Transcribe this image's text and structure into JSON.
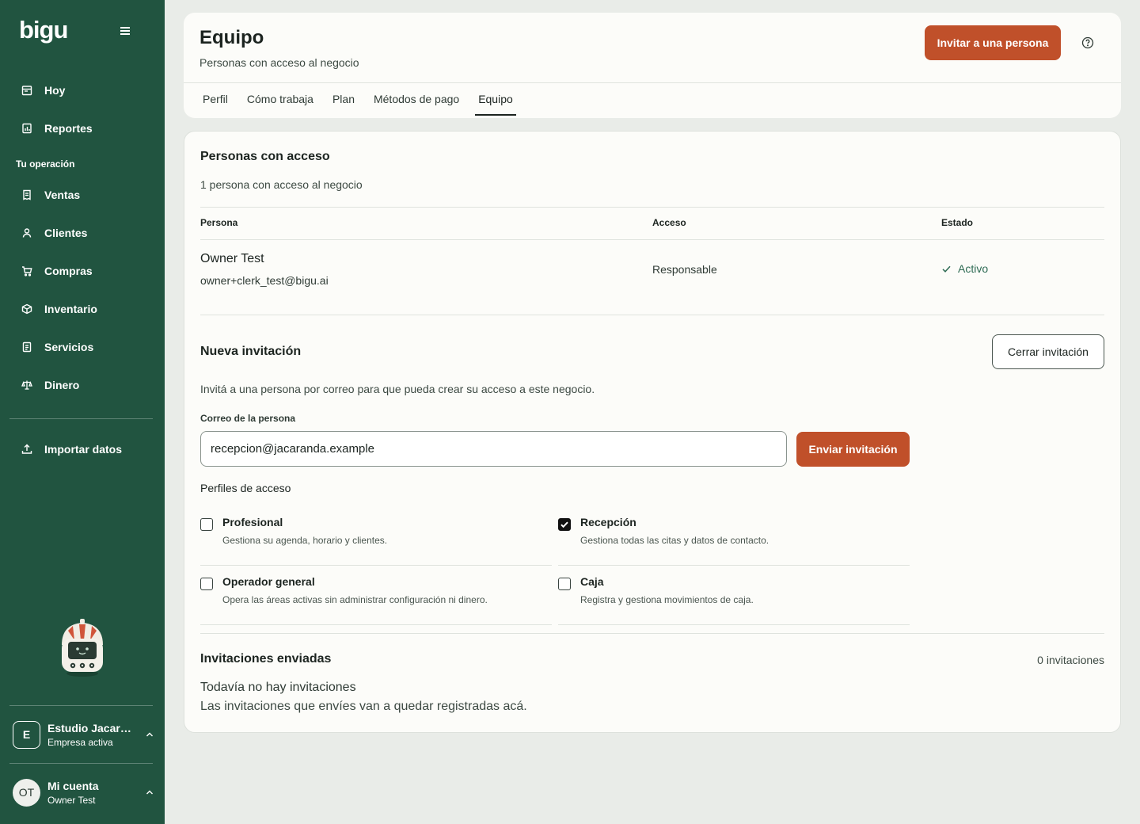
{
  "app": {
    "logo": "bigu"
  },
  "sidebar": {
    "items": [
      {
        "label": "Hoy",
        "icon": "calendar-icon"
      },
      {
        "label": "Reportes",
        "icon": "report-icon"
      }
    ],
    "section_label": "Tu operación",
    "operation_items": [
      {
        "label": "Ventas",
        "icon": "receipt-icon"
      },
      {
        "label": "Clientes",
        "icon": "user-icon"
      },
      {
        "label": "Compras",
        "icon": "cart-icon"
      },
      {
        "label": "Inventario",
        "icon": "box-icon"
      },
      {
        "label": "Servicios",
        "icon": "document-icon"
      },
      {
        "label": "Dinero",
        "icon": "scale-icon"
      }
    ],
    "import_label": "Importar datos",
    "business": {
      "badge": "E",
      "name": "Estudio Jacaranda",
      "subtitle": "Empresa activa"
    },
    "account": {
      "initials": "OT",
      "title": "Mi cuenta",
      "subtitle": "Owner Test"
    }
  },
  "header": {
    "title": "Equipo",
    "subtitle": "Personas con acceso al negocio",
    "invite_button": "Invitar a una persona",
    "tabs": [
      {
        "label": "Perfil"
      },
      {
        "label": "Cómo trabaja"
      },
      {
        "label": "Plan"
      },
      {
        "label": "Métodos de pago"
      },
      {
        "label": "Equipo"
      }
    ],
    "active_tab": "Equipo"
  },
  "access": {
    "title": "Personas con acceso",
    "summary": "1 persona con acceso al negocio",
    "columns": [
      "Persona",
      "Acceso",
      "Estado"
    ],
    "rows": [
      {
        "name": "Owner Test",
        "email": "owner+clerk_test@bigu.ai",
        "access": "Responsable",
        "status": "Activo"
      }
    ]
  },
  "invitation": {
    "title": "Nueva invitación",
    "close_button": "Cerrar invitación",
    "description": "Invitá a una persona por correo para que pueda crear su acceso a este negocio.",
    "email_label": "Correo de la persona",
    "email_value": "recepcion@jacaranda.example",
    "send_button": "Enviar invitación",
    "profiles_label": "Perfiles de acceso",
    "profiles": [
      {
        "title": "Profesional",
        "description": "Gestiona su agenda, horario y clientes.",
        "checked": false
      },
      {
        "title": "Recepción",
        "description": "Gestiona todas las citas y datos de contacto.",
        "checked": true
      },
      {
        "title": "Operador general",
        "description": "Opera las áreas activas sin administrar configuración ni dinero.",
        "checked": false
      },
      {
        "title": "Caja",
        "description": "Registra y gestiona movimientos de caja.",
        "checked": false
      }
    ]
  },
  "sent": {
    "title": "Invitaciones enviadas",
    "count": "0 invitaciones",
    "empty_title": "Todavía no hay invitaciones",
    "empty_text": "Las invitaciones que envíes van a quedar registradas acá."
  },
  "colors": {
    "sidebar": "#215440",
    "accent": "#c0502a",
    "background": "#e9ece8",
    "card": "#fcfcf9"
  }
}
